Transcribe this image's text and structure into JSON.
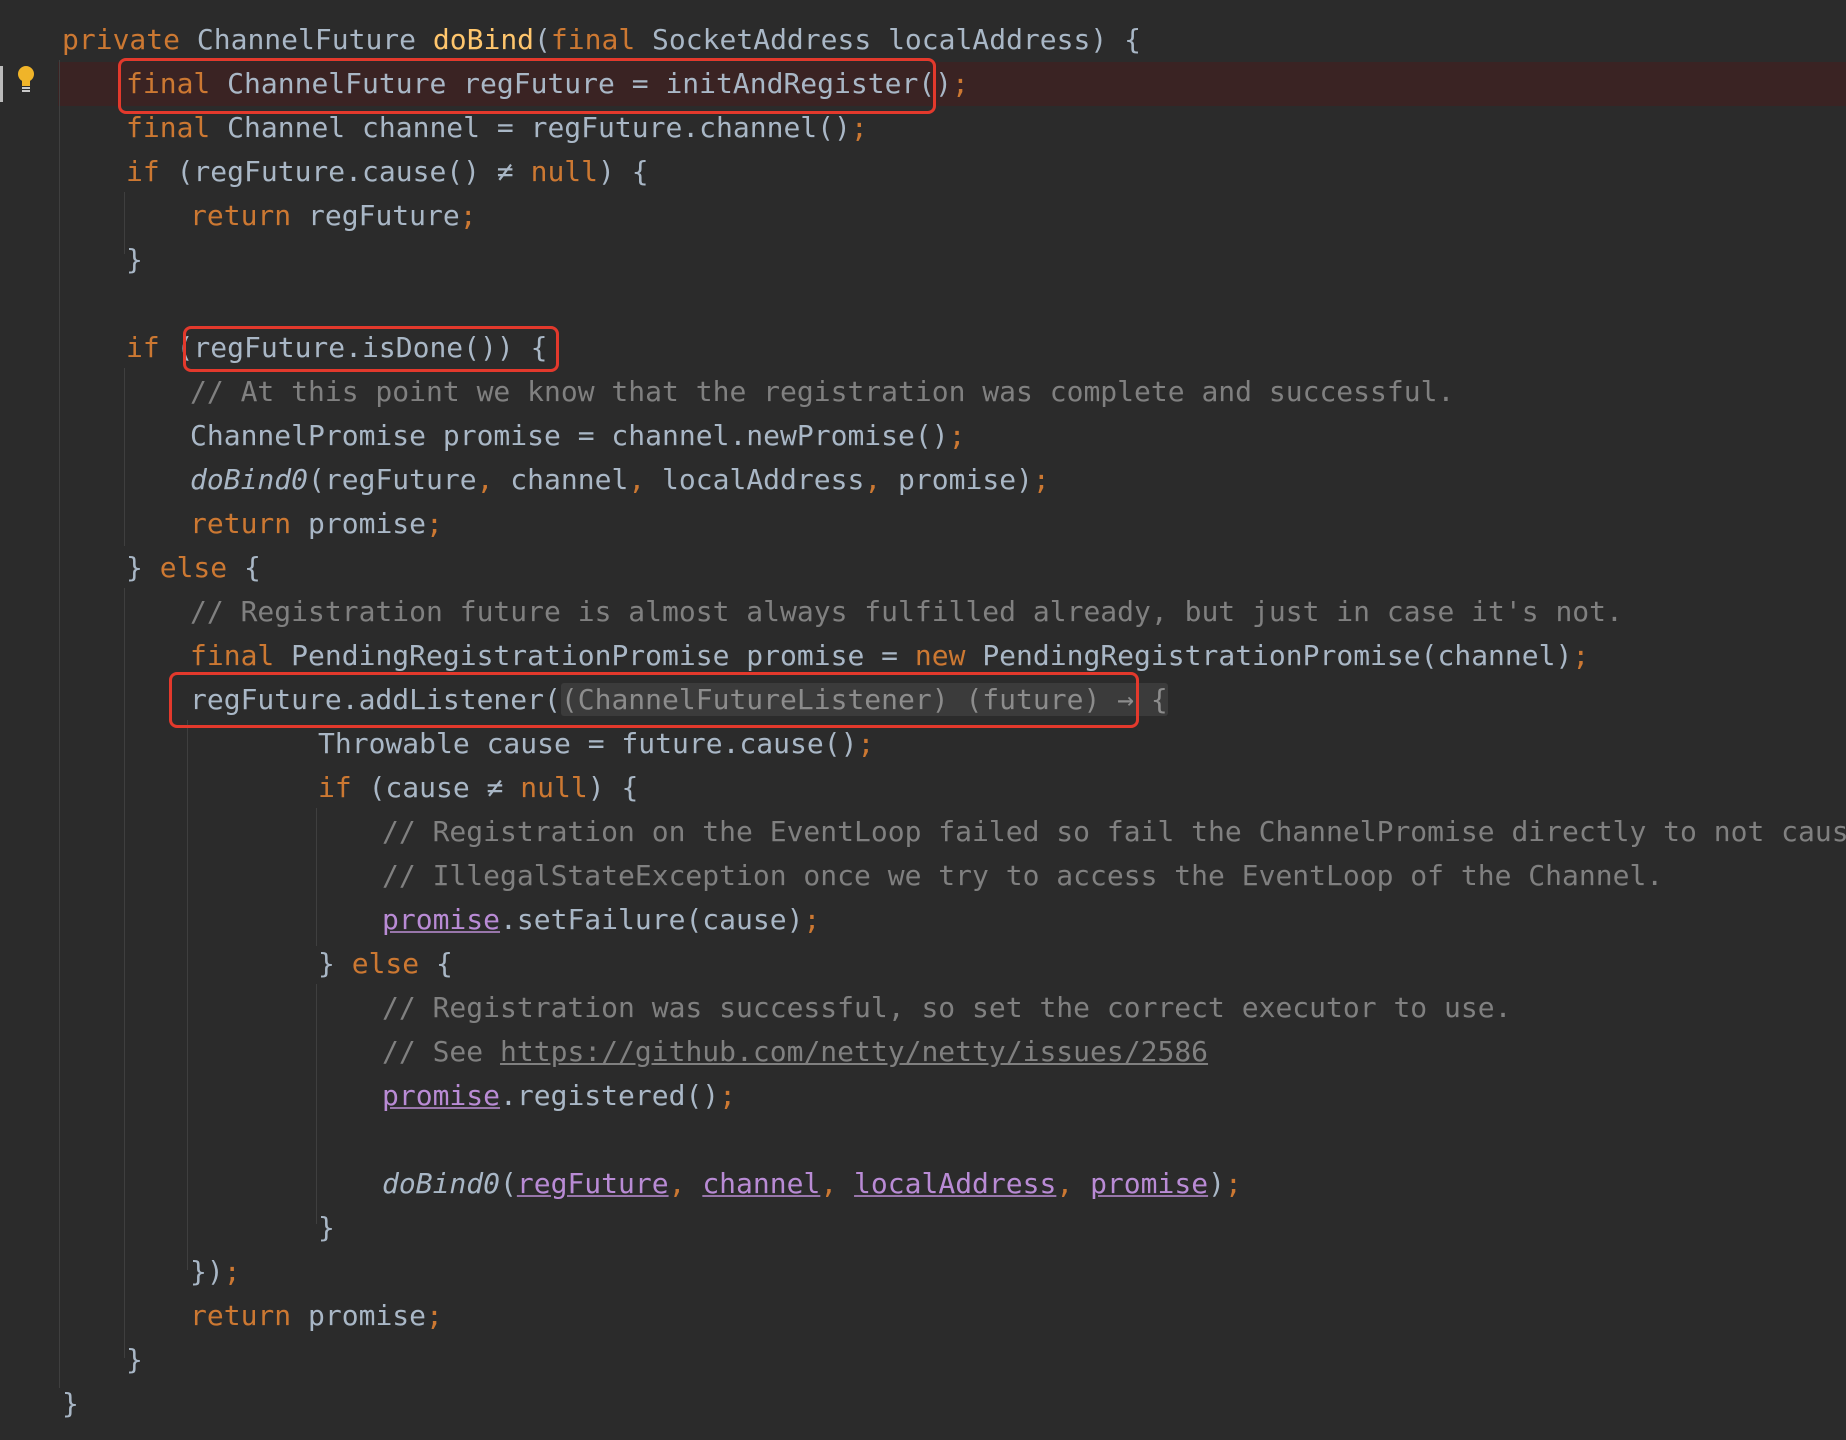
{
  "editor": {
    "theme_colors": {
      "background": "#2b2b2b",
      "keyword": "#cc7832",
      "method_decl": "#ffc66d",
      "default_text": "#a9b7c6",
      "comment": "#808080",
      "annotation_box": "#e3392c"
    },
    "gutter": {
      "icon": "lightbulb-icon"
    },
    "lines": {
      "l1": {
        "kw1": "private",
        "t1": " ChannelFuture ",
        "fn": "doBind",
        "t2": "(",
        "kw2": "final",
        "t3": " SocketAddress localAddress) {"
      },
      "l2": {
        "kw1": "final",
        "t1": " ChannelFuture regFuture = initAndRegister()",
        "sc": ";"
      },
      "l3": {
        "kw1": "final",
        "t1": " Channel channel = regFuture.channel()",
        "sc": ";"
      },
      "l4": {
        "kw1": "if",
        "t1": " (regFuture.cause() ≠ ",
        "kw2": "null",
        "t2": ") {"
      },
      "l5": {
        "kw1": "return",
        "t1": " regFuture",
        "sc": ";"
      },
      "l6": {
        "t1": "}"
      },
      "l7": {
        "kw1": "if",
        "t1": " (regFuture.isDone()) {"
      },
      "l8": {
        "cm": "// At this point we know that the registration was complete and successful."
      },
      "l9": {
        "t1": "ChannelPromise promise = channel.newPromise()",
        "sc": ";"
      },
      "l10": {
        "it": "doBind0",
        "t1": "(regFuture",
        "c1": ",",
        "t2": " channel",
        "c2": ",",
        "t3": " localAddress",
        "c3": ",",
        "t4": " promise)",
        "sc": ";"
      },
      "l11": {
        "kw1": "return",
        "t1": " promise",
        "sc": ";"
      },
      "l12": {
        "t1": "} ",
        "kw1": "else",
        "t2": " {"
      },
      "l13": {
        "cm": "// Registration future is almost always fulfilled already, but just in case it's not."
      },
      "l14": {
        "kw1": "final",
        "t1": " PendingRegistrationPromise promise = ",
        "kw2": "new",
        "t2": " PendingRegistrationPromise(channel)",
        "sc": ";"
      },
      "l15": {
        "t1": "regFuture.addListener(",
        "hint": "(ChannelFutureListener) (future) → {"
      },
      "l16": {
        "t1": "Throwable cause = future.cause()",
        "sc": ";"
      },
      "l17": {
        "kw1": "if",
        "t1": " (cause ≠ ",
        "kw2": "null",
        "t2": ") {"
      },
      "l18": {
        "cm": "// Registration on the EventLoop failed so fail the ChannelPromise directly to not cause an"
      },
      "l19": {
        "cm": "// IllegalStateException once we try to access the EventLoop of the Channel."
      },
      "l20": {
        "ref": "promise",
        "t1": ".setFailure(cause)",
        "sc": ";"
      },
      "l21": {
        "t1": "} ",
        "kw1": "else",
        "t2": " {"
      },
      "l22": {
        "cm": "// Registration was successful, so set the correct executor to use."
      },
      "l23": {
        "cm": "// See ",
        "url": "https://github.com/netty/netty/issues/2586"
      },
      "l24": {
        "ref": "promise",
        "t1": ".registered()",
        "sc": ";"
      },
      "l25": {
        "it": "doBind0",
        "t0": "(",
        "r1": "regFuture",
        "c1": ",",
        "r2": "channel",
        "c2": ",",
        "r3": "localAddress",
        "c3": ",",
        "r4": "promise",
        "t1": ")",
        "sc": ";"
      },
      "l26": {
        "t1": "}"
      },
      "l27": {
        "t1": "})",
        "sc": ";"
      },
      "l28": {
        "kw1": "return",
        "t1": " promise",
        "sc": ";"
      },
      "l29": {
        "t1": "}"
      },
      "l30": {
        "t1": "}"
      }
    }
  }
}
